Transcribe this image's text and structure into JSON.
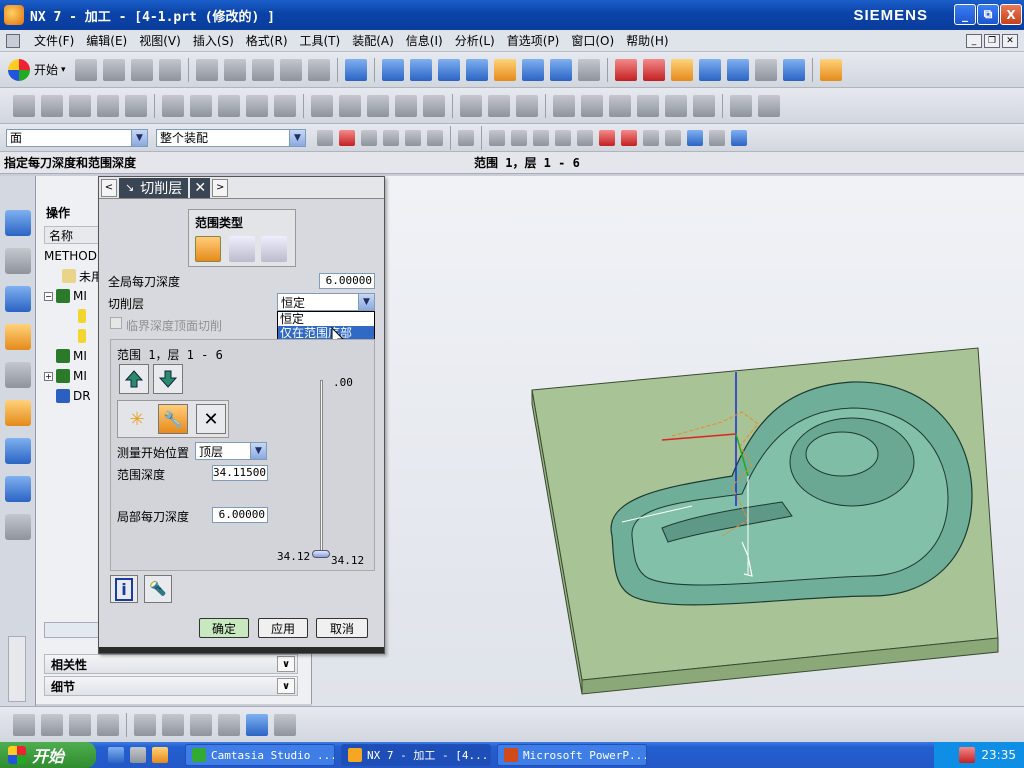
{
  "window": {
    "title": "NX 7 - 加工 - [4-1.prt  (修改的) ]",
    "brand": "SIEMENS",
    "controls": [
      "_",
      "⧉",
      "X"
    ]
  },
  "menu": {
    "items": [
      "文件(F)",
      "编辑(E)",
      "视图(V)",
      "插入(S)",
      "格式(R)",
      "工具(T)",
      "装配(A)",
      "信息(I)",
      "分析(L)",
      "首选项(P)",
      "窗口(O)",
      "帮助(H)"
    ]
  },
  "toolbar": {
    "start_label": "开始",
    "filter_combo": "面",
    "assembly_combo": "整个装配"
  },
  "prompt": {
    "left": "指定每刀深度和范围深度",
    "right": "范围 1，层 1 - 6"
  },
  "navigator": {
    "title": "操作",
    "column_name": "名称",
    "rows": [
      {
        "label": "METHOD",
        "indent": 0
      },
      {
        "label": "未用",
        "indent": 1
      },
      {
        "label": "MI",
        "indent": 1
      },
      {
        "label": "",
        "indent": 2
      },
      {
        "label": "",
        "indent": 2
      },
      {
        "label": "MI",
        "indent": 1
      },
      {
        "label": "MI",
        "indent": 1
      },
      {
        "label": "DR",
        "indent": 1
      }
    ],
    "sections": [
      "相关性",
      "细节"
    ]
  },
  "dialog": {
    "title": "切削层",
    "range_type_label": "范围类型",
    "global_depth_label": "全局每刀深度",
    "global_depth_value": "6.00000",
    "cut_levels_label": "切削层",
    "cut_levels_value": "恒定",
    "dropdown_options": [
      "恒定",
      "仅在范围底部"
    ],
    "critical_depth_label": "临界深度顶面切削",
    "range_info": "范围 1，层 1 - 6",
    "measure_from_label": "测量开始位置",
    "measure_from_value": "顶层",
    "range_depth_label": "范围深度",
    "range_depth_value": "34.11500",
    "local_depth_label": "局部每刀深度",
    "local_depth_value": "6.00000",
    "slider_top": ".00",
    "slider_bottom_left": "34.12",
    "slider_bottom_right": "34.12",
    "ok": "确定",
    "apply": "应用",
    "cancel": "取消"
  },
  "taskbar": {
    "start": "开始",
    "tasks": [
      "Camtasia Studio ...",
      "NX 7 - 加工 - [4...",
      "Microsoft PowerP..."
    ],
    "clock": "23:35"
  },
  "colors": {
    "title_blue": "#0a43a8",
    "model_green": "#6fae98",
    "base_plate": "#a8c496",
    "ok_green": "#c8e8c0"
  }
}
